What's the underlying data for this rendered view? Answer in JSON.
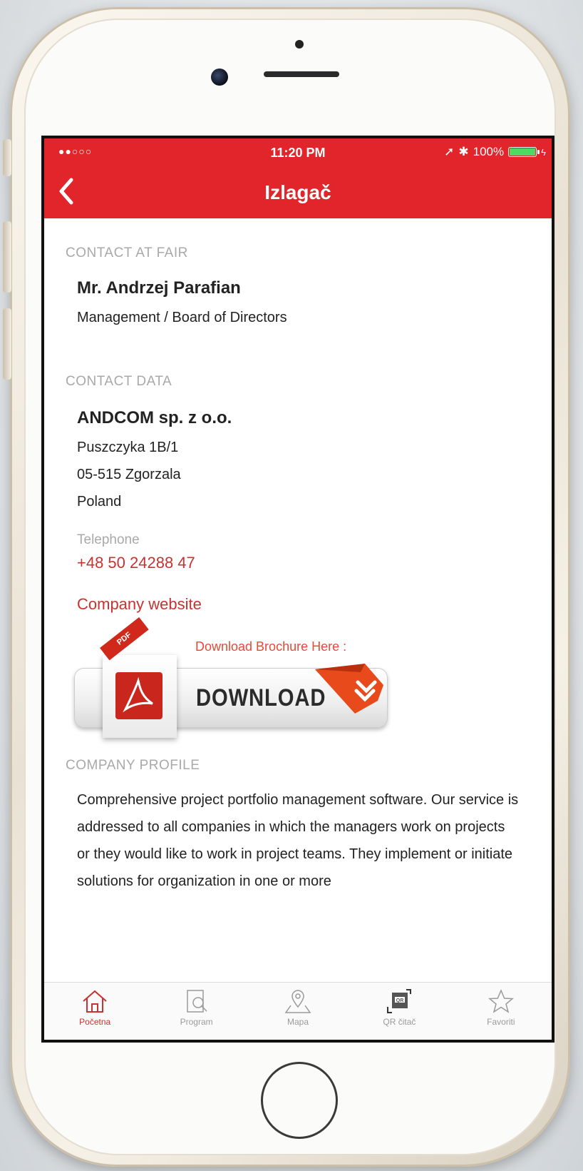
{
  "status": {
    "signal": "●●○○○",
    "time": "11:20 PM",
    "battery": "100%",
    "battery_color": "#4cd964"
  },
  "nav": {
    "title": "Izlagač",
    "back_icon": "chevron-left-icon",
    "bar_color": "#e1252a"
  },
  "contact_at_fair": {
    "heading": "CONTACT AT FAIR",
    "name": "Mr. Andrzej Parafian",
    "role": "Management / Board of Directors"
  },
  "contact_data": {
    "heading": "CONTACT DATA",
    "company": "ANDCOM sp. z o.o.",
    "address_line1": "Puszczyka 1B/1",
    "address_line2": "05-515 Zgorzala",
    "country": "Poland",
    "telephone_label": "Telephone",
    "telephone": "+48 50 24288 47",
    "website_link": "Company website"
  },
  "download": {
    "header": "Download Brochure Here :",
    "button_label": "DOWNLOAD",
    "ribbon": "PDF"
  },
  "profile": {
    "heading": "COMPANY PROFILE",
    "text": "Comprehensive project portfolio management software. Our service is addressed to all companies in which the managers work on projects or they would like to work in project teams. They implement or initiate solutions for organization in one or more"
  },
  "tabs": [
    {
      "label": "Početna",
      "icon": "home-icon",
      "active": true
    },
    {
      "label": "Program",
      "icon": "program-search-icon",
      "active": false
    },
    {
      "label": "Mapa",
      "icon": "map-pin-icon",
      "active": false
    },
    {
      "label": "QR čitač",
      "icon": "qr-code-icon",
      "active": false
    },
    {
      "label": "Favoriti",
      "icon": "star-icon",
      "active": false
    }
  ],
  "accent_color": "#c83230"
}
